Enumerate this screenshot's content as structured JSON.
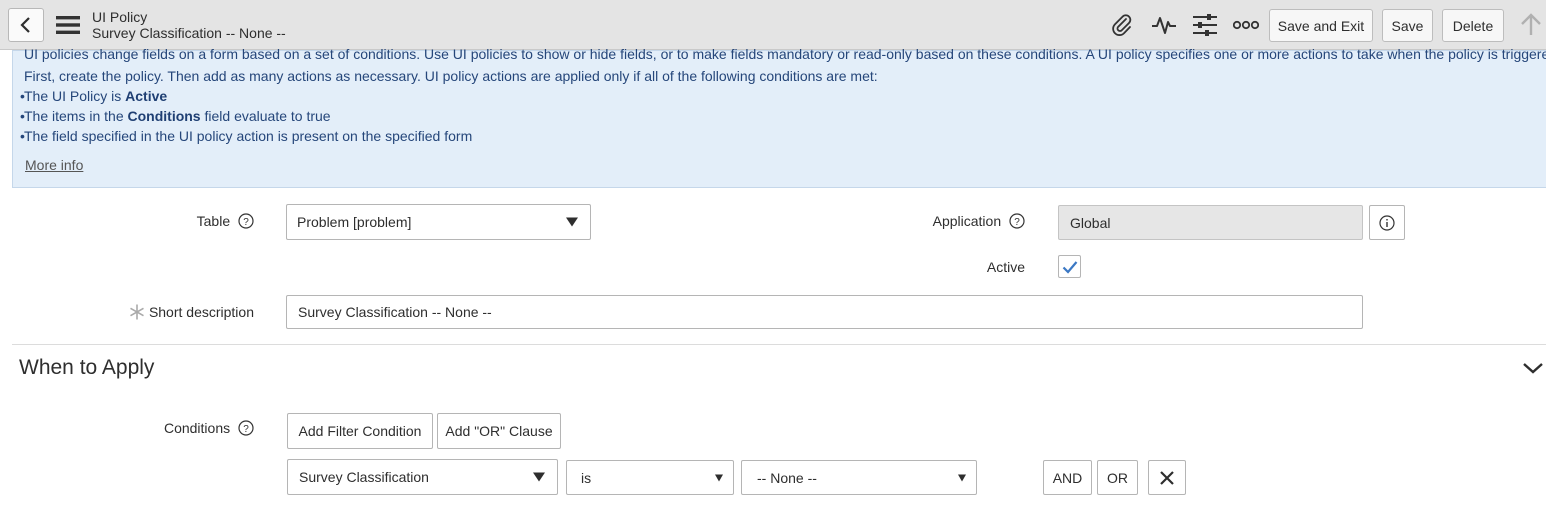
{
  "header": {
    "title": "UI Policy",
    "subtitle": "Survey Classification -- None --",
    "icons": [
      "back-icon",
      "hamburger-menu-icon",
      "paperclip-icon",
      "activity-icon",
      "sliders-icon",
      "more-icon",
      "up-arrow-icon"
    ],
    "buttons": {
      "save_exit": "Save and Exit",
      "save": "Save",
      "delete": "Delete"
    }
  },
  "info": {
    "line1": "UI policies change fields on a form based on a set of conditions. Use UI policies to show or hide fields, or to make fields mandatory or read-only based on these conditions. A UI policy specifies one or more actions to take when the policy is triggered.",
    "line2": "First, create the policy. Then add as many actions as necessary. UI policy actions are applied only if all of the following conditions are met:",
    "bullet1_pre": "The UI Policy is ",
    "bullet1_bold": "Active",
    "bullet2_pre": "The items in the ",
    "bullet2_bold": "Conditions",
    "bullet2_post": " field evaluate to true",
    "bullet3": "The field specified in the UI policy action is present on the specified form",
    "more_info": "More info"
  },
  "form": {
    "table_label": "Table",
    "table_value": "Problem [problem]",
    "application_label": "Application",
    "application_value": "Global",
    "active_label": "Active",
    "active_checked": true,
    "short_desc_label": "Short description",
    "short_desc_value": "Survey Classification -- None --"
  },
  "when_to_apply": {
    "title": "When to Apply",
    "conditions_label": "Conditions",
    "add_filter": "Add Filter Condition",
    "add_or": "Add \"OR\" Clause",
    "field": "Survey Classification",
    "operator": "is",
    "value": "-- None --",
    "and": "AND",
    "or": "OR"
  },
  "colors": {
    "info_bg": "#e3eef9",
    "info_text": "#25467a",
    "check": "#3b78c4"
  }
}
